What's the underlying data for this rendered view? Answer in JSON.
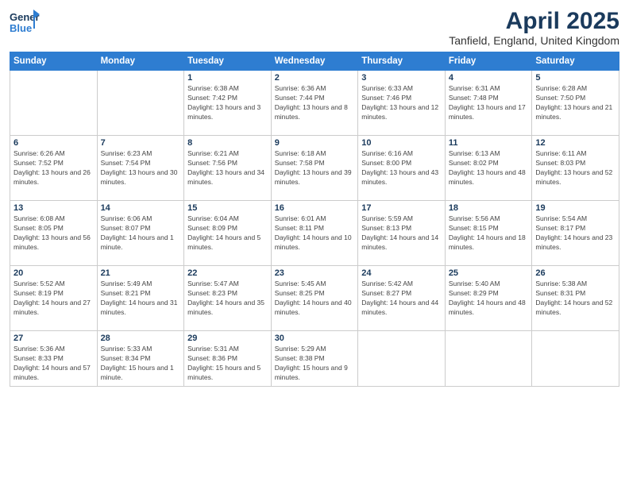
{
  "header": {
    "logo_line1": "General",
    "logo_line2": "Blue",
    "month": "April 2025",
    "location": "Tanfield, England, United Kingdom"
  },
  "weekdays": [
    "Sunday",
    "Monday",
    "Tuesday",
    "Wednesday",
    "Thursday",
    "Friday",
    "Saturday"
  ],
  "weeks": [
    [
      {
        "day": "",
        "info": ""
      },
      {
        "day": "",
        "info": ""
      },
      {
        "day": "1",
        "info": "Sunrise: 6:38 AM\nSunset: 7:42 PM\nDaylight: 13 hours and 3 minutes."
      },
      {
        "day": "2",
        "info": "Sunrise: 6:36 AM\nSunset: 7:44 PM\nDaylight: 13 hours and 8 minutes."
      },
      {
        "day": "3",
        "info": "Sunrise: 6:33 AM\nSunset: 7:46 PM\nDaylight: 13 hours and 12 minutes."
      },
      {
        "day": "4",
        "info": "Sunrise: 6:31 AM\nSunset: 7:48 PM\nDaylight: 13 hours and 17 minutes."
      },
      {
        "day": "5",
        "info": "Sunrise: 6:28 AM\nSunset: 7:50 PM\nDaylight: 13 hours and 21 minutes."
      }
    ],
    [
      {
        "day": "6",
        "info": "Sunrise: 6:26 AM\nSunset: 7:52 PM\nDaylight: 13 hours and 26 minutes."
      },
      {
        "day": "7",
        "info": "Sunrise: 6:23 AM\nSunset: 7:54 PM\nDaylight: 13 hours and 30 minutes."
      },
      {
        "day": "8",
        "info": "Sunrise: 6:21 AM\nSunset: 7:56 PM\nDaylight: 13 hours and 34 minutes."
      },
      {
        "day": "9",
        "info": "Sunrise: 6:18 AM\nSunset: 7:58 PM\nDaylight: 13 hours and 39 minutes."
      },
      {
        "day": "10",
        "info": "Sunrise: 6:16 AM\nSunset: 8:00 PM\nDaylight: 13 hours and 43 minutes."
      },
      {
        "day": "11",
        "info": "Sunrise: 6:13 AM\nSunset: 8:02 PM\nDaylight: 13 hours and 48 minutes."
      },
      {
        "day": "12",
        "info": "Sunrise: 6:11 AM\nSunset: 8:03 PM\nDaylight: 13 hours and 52 minutes."
      }
    ],
    [
      {
        "day": "13",
        "info": "Sunrise: 6:08 AM\nSunset: 8:05 PM\nDaylight: 13 hours and 56 minutes."
      },
      {
        "day": "14",
        "info": "Sunrise: 6:06 AM\nSunset: 8:07 PM\nDaylight: 14 hours and 1 minute."
      },
      {
        "day": "15",
        "info": "Sunrise: 6:04 AM\nSunset: 8:09 PM\nDaylight: 14 hours and 5 minutes."
      },
      {
        "day": "16",
        "info": "Sunrise: 6:01 AM\nSunset: 8:11 PM\nDaylight: 14 hours and 10 minutes."
      },
      {
        "day": "17",
        "info": "Sunrise: 5:59 AM\nSunset: 8:13 PM\nDaylight: 14 hours and 14 minutes."
      },
      {
        "day": "18",
        "info": "Sunrise: 5:56 AM\nSunset: 8:15 PM\nDaylight: 14 hours and 18 minutes."
      },
      {
        "day": "19",
        "info": "Sunrise: 5:54 AM\nSunset: 8:17 PM\nDaylight: 14 hours and 23 minutes."
      }
    ],
    [
      {
        "day": "20",
        "info": "Sunrise: 5:52 AM\nSunset: 8:19 PM\nDaylight: 14 hours and 27 minutes."
      },
      {
        "day": "21",
        "info": "Sunrise: 5:49 AM\nSunset: 8:21 PM\nDaylight: 14 hours and 31 minutes."
      },
      {
        "day": "22",
        "info": "Sunrise: 5:47 AM\nSunset: 8:23 PM\nDaylight: 14 hours and 35 minutes."
      },
      {
        "day": "23",
        "info": "Sunrise: 5:45 AM\nSunset: 8:25 PM\nDaylight: 14 hours and 40 minutes."
      },
      {
        "day": "24",
        "info": "Sunrise: 5:42 AM\nSunset: 8:27 PM\nDaylight: 14 hours and 44 minutes."
      },
      {
        "day": "25",
        "info": "Sunrise: 5:40 AM\nSunset: 8:29 PM\nDaylight: 14 hours and 48 minutes."
      },
      {
        "day": "26",
        "info": "Sunrise: 5:38 AM\nSunset: 8:31 PM\nDaylight: 14 hours and 52 minutes."
      }
    ],
    [
      {
        "day": "27",
        "info": "Sunrise: 5:36 AM\nSunset: 8:33 PM\nDaylight: 14 hours and 57 minutes."
      },
      {
        "day": "28",
        "info": "Sunrise: 5:33 AM\nSunset: 8:34 PM\nDaylight: 15 hours and 1 minute."
      },
      {
        "day": "29",
        "info": "Sunrise: 5:31 AM\nSunset: 8:36 PM\nDaylight: 15 hours and 5 minutes."
      },
      {
        "day": "30",
        "info": "Sunrise: 5:29 AM\nSunset: 8:38 PM\nDaylight: 15 hours and 9 minutes."
      },
      {
        "day": "",
        "info": ""
      },
      {
        "day": "",
        "info": ""
      },
      {
        "day": "",
        "info": ""
      }
    ]
  ]
}
